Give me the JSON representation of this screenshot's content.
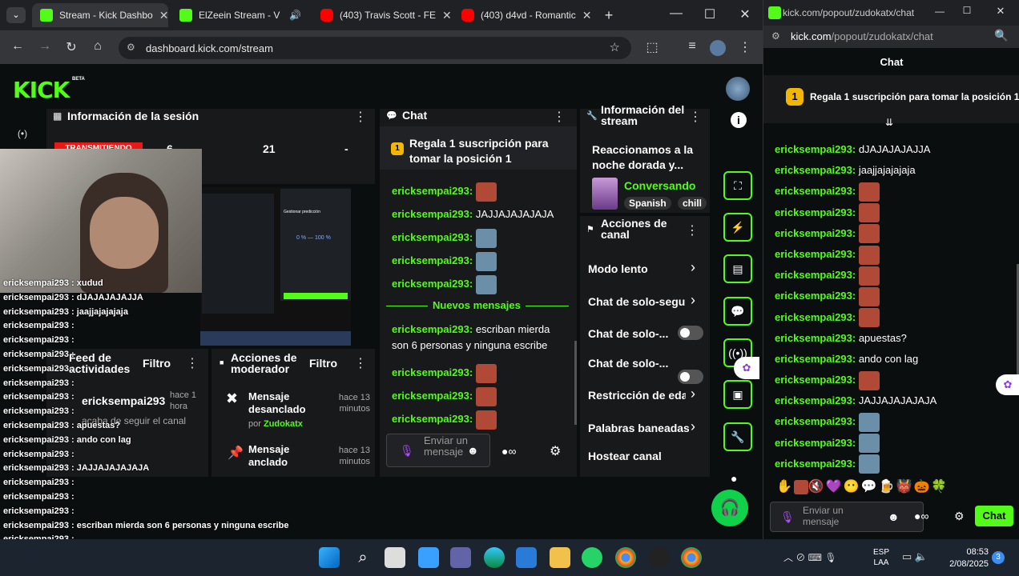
{
  "browser": {
    "tabs": [
      {
        "title": "Stream - Kick Dashbo",
        "favicon": "kick"
      },
      {
        "title": "ElZeein Stream - V",
        "favicon": "kick"
      },
      {
        "title": "(403) Travis Scott - FE",
        "favicon": "youtube"
      },
      {
        "title": "(403) d4vd - Romantic",
        "favicon": "youtube"
      }
    ],
    "url": "dashboard.kick.com/stream"
  },
  "kick": {
    "logo": "KICK",
    "beta": "BETA"
  },
  "session": {
    "title": "Información de la sesión",
    "badge": "TRANSMITIENDO",
    "stat1": "6",
    "stat2": "21",
    "stat3": "-"
  },
  "activity": {
    "title": "Feed de actividades",
    "filter": "Filtro",
    "user": "ericksempai293",
    "time": "hace 1 hora",
    "text": "acaba de seguir el canal"
  },
  "modactions": {
    "title": "Acciones de moderador",
    "filter": "Filtro",
    "items": [
      {
        "title": "Mensaje desanclado",
        "by": "por",
        "byuser": "Zudokatx",
        "time": "hace 13 minutos"
      },
      {
        "title": "Mensaje anclado",
        "time": "hace 13 minutos"
      }
    ]
  },
  "chat": {
    "title": "Chat",
    "pinned": "Regala 1 suscripción para tomar la posición 1",
    "pinned_num": "1",
    "new_messages": "Nuevos mensajes",
    "placeholder": "Enviar un mensaje",
    "msgs": [
      {
        "user": "ericksempai293:",
        "text": "",
        "emote": "red"
      },
      {
        "user": "ericksempai293:",
        "text": "JAJJAJAJAJAJA",
        "emote": ""
      },
      {
        "user": "ericksempai293:",
        "text": "",
        "emote": "blue"
      },
      {
        "user": "ericksempai293:",
        "text": "",
        "emote": "blue"
      },
      {
        "user": "ericksempai293:",
        "text": "",
        "emote": "blue"
      }
    ],
    "msgs2": [
      {
        "user": "ericksempai293:",
        "text": "escriban mierda son 6 personas y ninguna escribe"
      },
      {
        "user": "ericksempai293:",
        "text": "",
        "emote": "red"
      },
      {
        "user": "ericksempai293:",
        "text": "",
        "emote": "red"
      },
      {
        "user": "ericksempai293:",
        "text": "",
        "emote": "red"
      }
    ]
  },
  "streaminfo": {
    "title": "Información del stream",
    "stream_title": "Reaccionamos a la noche dorada y...",
    "category": "Conversando",
    "tags": [
      "Spanish",
      "chill"
    ]
  },
  "channel": {
    "title": "Acciones de canal",
    "items": [
      "Modo lento",
      "Chat de solo-segui",
      "Chat de solo-...",
      "Chat de solo-...",
      "Restricción de edad",
      "Palabras baneadas",
      "Hostear canal"
    ]
  },
  "overlay": {
    "lines": [
      "ericksempai293 : xudud",
      "ericksempai293 : dJAJAJAJAJJA",
      "ericksempai293 : jaajjajajajaja",
      "ericksempai293 :",
      "ericksempai293 :",
      "ericksempai293 :",
      "ericksempai293 :",
      "ericksempai293 :",
      "ericksempai293 :",
      "ericksempai293 :",
      "ericksempai293 : apuestas?",
      "ericksempai293 : ando con lag",
      "ericksempai293 :",
      "ericksempai293 : JAJJAJAJAJAJA",
      "ericksempai293 :",
      "ericksempai293 :",
      "ericksempai293 :",
      "ericksempai293 : escriban mierda son 6 personas y ninguna escribe",
      "ericksempai293 :",
      "ericksempai293 :",
      "ericksempai293 :"
    ]
  },
  "preview": {
    "title": "Gestionar predicción",
    "percent": "0 % — 100 %"
  },
  "popout": {
    "url_domain": "kick.com",
    "url_path": "/popout/zudokatx/chat",
    "title": "Chat",
    "pinned": "Regala 1 suscripción para tomar la posición 1",
    "pinned_num": "1",
    "placeholder": "Enviar un mensaje",
    "send": "Chat",
    "msgs": [
      {
        "user": "ericksempai293:",
        "text": "dJAJAJAJAJJA",
        "emote": ""
      },
      {
        "user": "ericksempai293:",
        "text": "jaajjajajajaja",
        "emote": ""
      },
      {
        "user": "ericksempai293:",
        "text": "",
        "emote": "red"
      },
      {
        "user": "ericksempai293:",
        "text": "",
        "emote": "red"
      },
      {
        "user": "ericksempai293:",
        "text": "",
        "emote": "red"
      },
      {
        "user": "ericksempai293:",
        "text": "",
        "emote": "red"
      },
      {
        "user": "ericksempai293:",
        "text": "",
        "emote": "red"
      },
      {
        "user": "ericksempai293:",
        "text": "",
        "emote": "red"
      },
      {
        "user": "ericksempai293:",
        "text": "",
        "emote": "red"
      },
      {
        "user": "ericksempai293:",
        "text": "apuestas?",
        "emote": ""
      },
      {
        "user": "ericksempai293:",
        "text": "ando con lag",
        "emote": ""
      },
      {
        "user": "ericksempai293:",
        "text": "",
        "emote": "red"
      },
      {
        "user": "ericksempai293:",
        "text": "JAJJAJAJAJAJA",
        "emote": ""
      },
      {
        "user": "ericksempai293:",
        "text": "",
        "emote": "blue"
      },
      {
        "user": "ericksempai293:",
        "text": "",
        "emote": "blue"
      },
      {
        "user": "ericksempai293:",
        "text": "",
        "emote": "blue"
      }
    ]
  },
  "taskbar": {
    "lang1": "ESP",
    "lang2": "LAA",
    "time": "08:53",
    "date": "2/08/2025",
    "badge": "3"
  }
}
